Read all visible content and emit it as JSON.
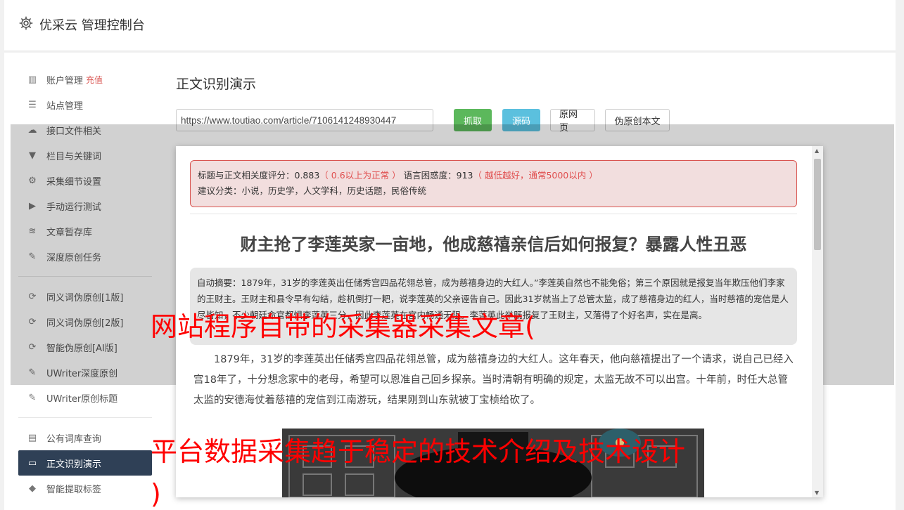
{
  "header": {
    "title": "优采云 管理控制台"
  },
  "sidebar": {
    "group1": [
      {
        "label": "账户管理",
        "badge": "充值",
        "icon": "bar-chart-icon"
      },
      {
        "label": "站点管理",
        "icon": "server-icon"
      },
      {
        "label": "接口文件相关",
        "icon": "cloud-upload-icon"
      },
      {
        "label": "栏目与关键词",
        "icon": "filter-icon"
      },
      {
        "label": "采集细节设置",
        "icon": "gears-icon"
      },
      {
        "label": "手动运行测试",
        "icon": "play-icon"
      },
      {
        "label": "文章暂存库",
        "icon": "database-icon"
      },
      {
        "label": "深度原创任务",
        "icon": "edit-icon"
      }
    ],
    "group2": [
      {
        "label": "同义词伪原创[1版]",
        "icon": "refresh-icon"
      },
      {
        "label": "同义词伪原创[2版]",
        "icon": "refresh-icon"
      },
      {
        "label": "智能伪原创[AI版]",
        "icon": "refresh-icon"
      },
      {
        "label": "UWriter深度原创",
        "icon": "edit-icon"
      },
      {
        "label": "UWriter原创标题",
        "icon": "edit-icon"
      }
    ],
    "group3": [
      {
        "label": "公有词库查询",
        "icon": "book-icon"
      },
      {
        "label": "正文识别演示",
        "icon": "monitor-icon",
        "active": true
      },
      {
        "label": "智能提取标签",
        "icon": "tag-icon"
      }
    ]
  },
  "main": {
    "title": "正文识别演示",
    "url_value": "https://www.toutiao.com/article/7106141248930447",
    "buttons": {
      "grab": "抓取",
      "source": "源码",
      "original": "原网页",
      "rewrite": "伪原创本文"
    }
  },
  "modal": {
    "alert": {
      "line1_prefix": "标题与正文相关度评分：0.883",
      "line1_hint1": "（ 0.6以上为正常 ）",
      "line1_mid": "语言困惑度：913",
      "line1_hint2": "（ 越低越好，通常5000以内 ）",
      "line2": "建议分类：小说，历史学，人文学科，历史话题，民俗传统"
    },
    "article_title": "财主抢了李莲英家一亩地，他成慈禧亲信后如何报复？暴露人性丑恶",
    "summary": "自动摘要：1879年，31岁的李莲英出任储秀宫四品花翎总管，成为慈禧身边的大红人。”李莲英自然也不能免俗；第三个原因就是报复当年欺压他们李家的王财主。王财主和县令早有勾结，趁机倒打一耙，说李莲英的父亲诬告自己。因此31岁就当上了总管太监，成了慈禧身边的红人，当时慈禧的宠信是人尽皆知，不少朝廷命官都惧李莲英三分，因此李莲英在宫内畅通无阻。李莲英此举既报复了王财主，又落得了个好名声，实在是高。",
    "body": "1879年，31岁的李莲英出任储秀宫四品花翎总管，成为慈禧身边的大红人。这年春天，他向慈禧提出了一个请求，说自己已经入宫18年了，十分想念家中的老母，希望可以恩准自己回乡探亲。当时清朝有明确的规定，太监无故不可以出宫。十年前，时任大总管太监的安德海仗着慈禧的宠信到江南游玩，结果刚到山东就被丁宝桢给砍了。"
  },
  "overlay": {
    "line1": "网站程序自带的采集器采集文章(",
    "line2": "平台数据采集趋于稳定的技术介绍及技术设计",
    "line3": ")"
  },
  "colors": {
    "accent_active": "#2f4056",
    "grab_green": "#5cb85c",
    "source_blue": "#5bc0de",
    "alert_red": "#d9534f",
    "overlay_red": "#ff0000"
  }
}
